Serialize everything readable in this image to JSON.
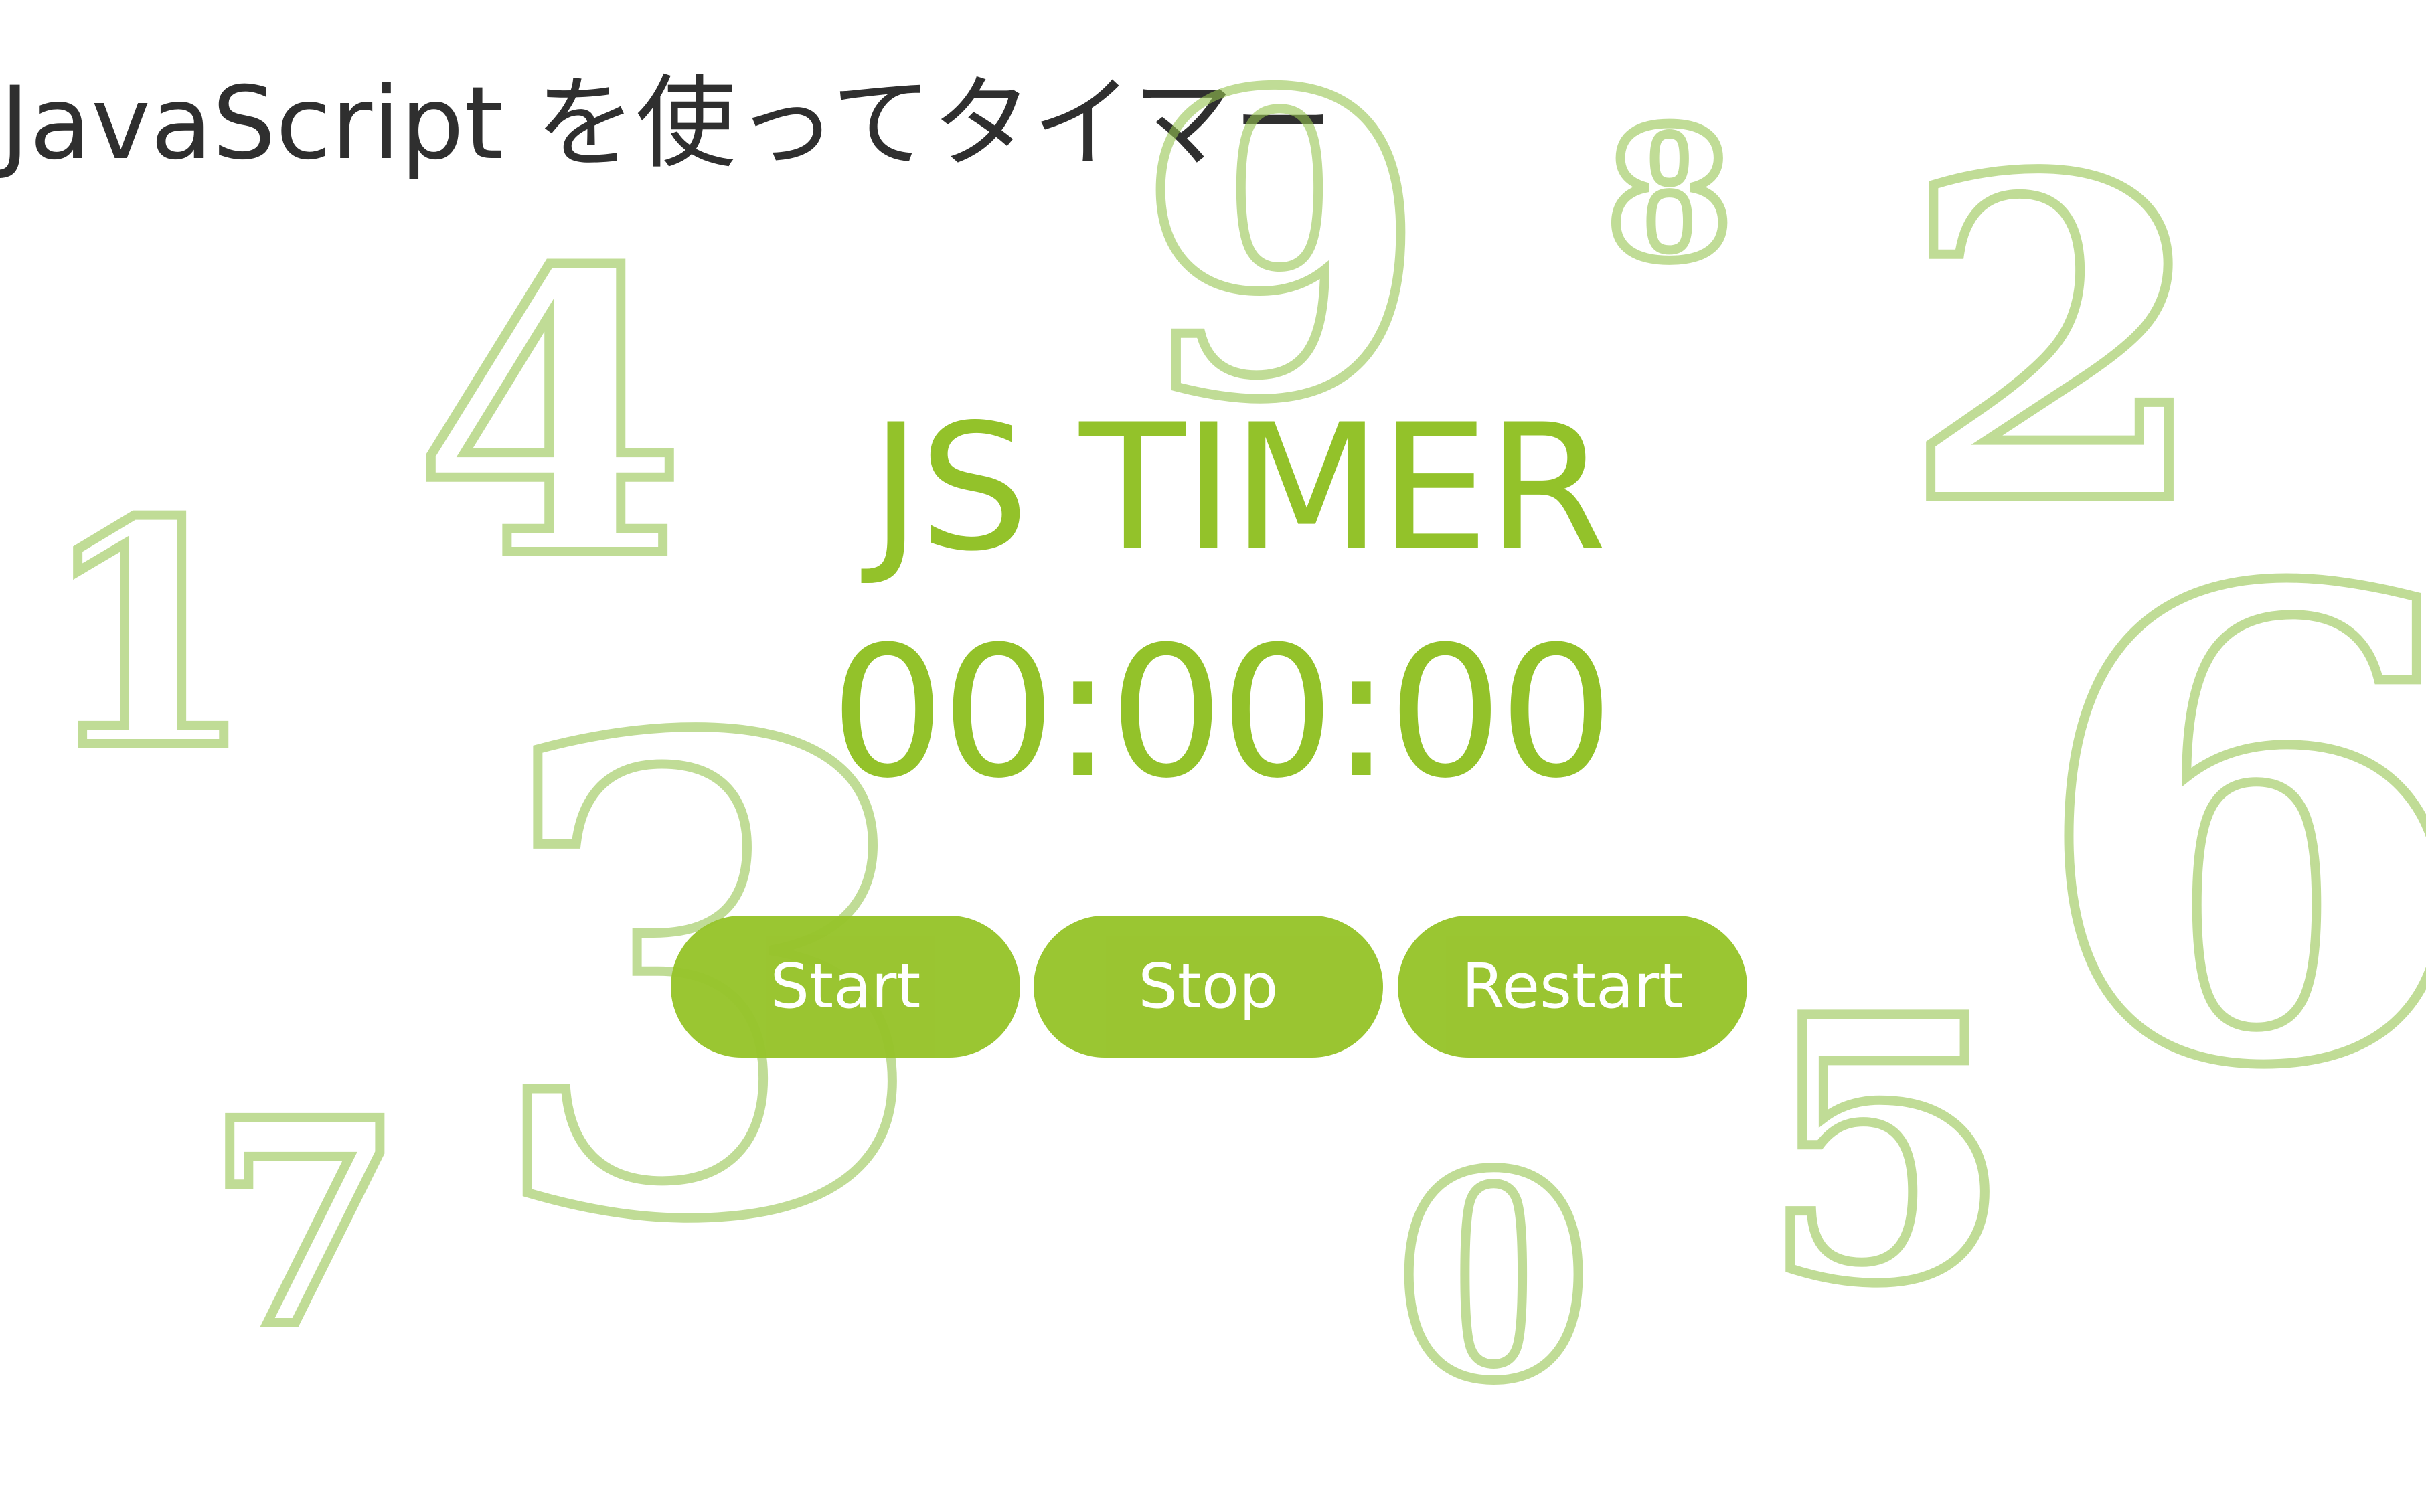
{
  "page": {
    "heading": "JavaScript を使ってタイマー"
  },
  "timer": {
    "title": "JS TIMER",
    "display": "00:00:00"
  },
  "buttons": {
    "start": "Start",
    "stop": "Stop",
    "restart": "Restart"
  },
  "background_digits": {
    "d0": "0",
    "d1": "1",
    "d2": "2",
    "d3": "3",
    "d4": "4",
    "d5": "5",
    "d6": "6",
    "d7": "7",
    "d8": "8",
    "d9": "9"
  },
  "colors": {
    "accent": "#93c22a",
    "button": "#97c42b",
    "digit_outline": "#96c450",
    "heading": "#2f2f2f",
    "background": "#ffffff"
  }
}
